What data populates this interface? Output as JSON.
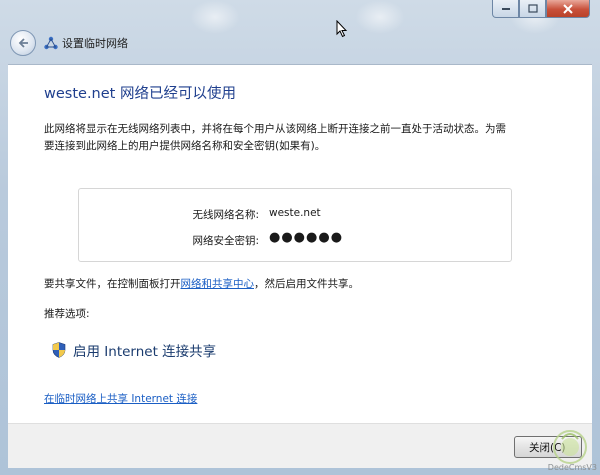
{
  "nav": {
    "title": "设置临时网络"
  },
  "content": {
    "headline": "weste.net 网络已经可以使用",
    "description": "此网络将显示在无线网络列表中，并将在每个用户从该网络上断开连接之前一直处于活动状态。为需要连接到此网络上的用户提供网络名称和安全密钥(如果有)。",
    "info": {
      "name_label": "无线网络名称:",
      "name_value": "weste.net",
      "key_label": "网络安全密钥:",
      "key_value": "●●●●●●"
    },
    "share": {
      "prefix": "要共享文件，在控制面板打开",
      "link": "网络和共享中心",
      "suffix": "，然后启用文件共享。"
    },
    "recommended_label": "推荐选项:",
    "option_label": "启用 Internet 连接共享",
    "bottom_link": "在临时网络上共享 Internet 连接"
  },
  "footer": {
    "close_label": "关闭(C)"
  },
  "watermark": {
    "text": "DedeCmsV3"
  },
  "colors": {
    "headline": "#1f3f8e",
    "link": "#1a5ec4",
    "background": "#ffffff",
    "footer": "#f0f0f0"
  }
}
